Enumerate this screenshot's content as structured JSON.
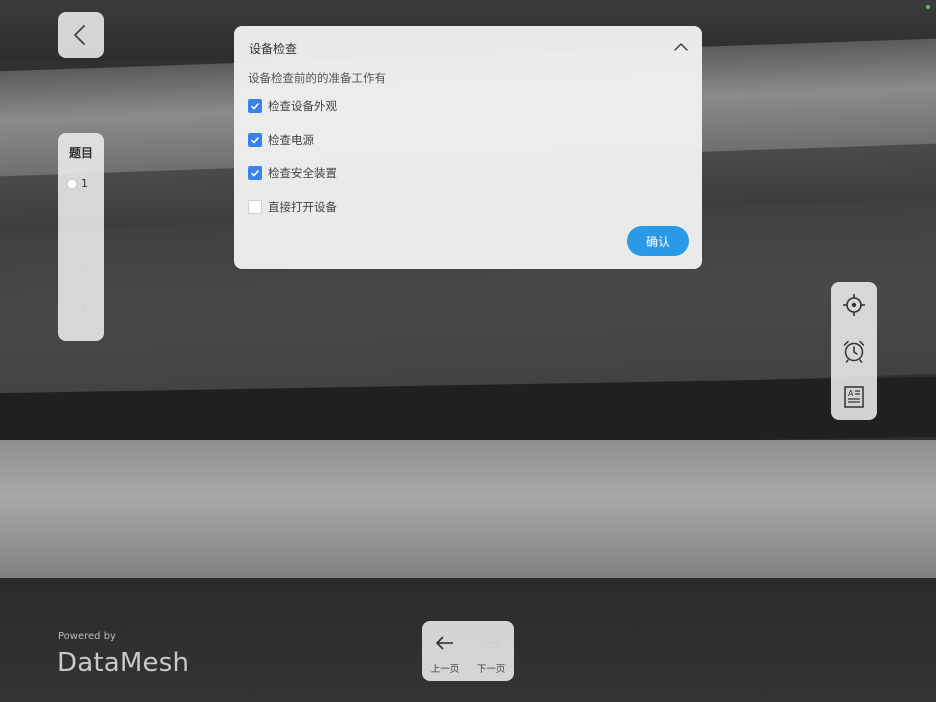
{
  "progress": {
    "title": "题目",
    "steps": [
      "1",
      "2",
      "3",
      "4"
    ],
    "current_step": 1
  },
  "dialog": {
    "title": "设备检查",
    "description": "设备检查前的的准备工作有",
    "options": [
      {
        "label": "检查设备外观",
        "checked": true
      },
      {
        "label": "检查电源",
        "checked": true
      },
      {
        "label": "检查安全装置",
        "checked": true
      },
      {
        "label": "直接打开设备",
        "checked": false
      }
    ],
    "confirm_label": "确认"
  },
  "tools": [
    "crosshair-icon",
    "alarm-clock-icon",
    "document-icon"
  ],
  "pager": {
    "prev_label": "上一页",
    "next_label": "下一页",
    "next_enabled": false
  },
  "branding": {
    "powered_by": "Powered by",
    "brand_name": "DataMesh"
  },
  "colors": {
    "checkbox_checked": "#3b82e8",
    "confirm_button": "#2a9ae6",
    "status_dot": "#3ecf5c"
  }
}
